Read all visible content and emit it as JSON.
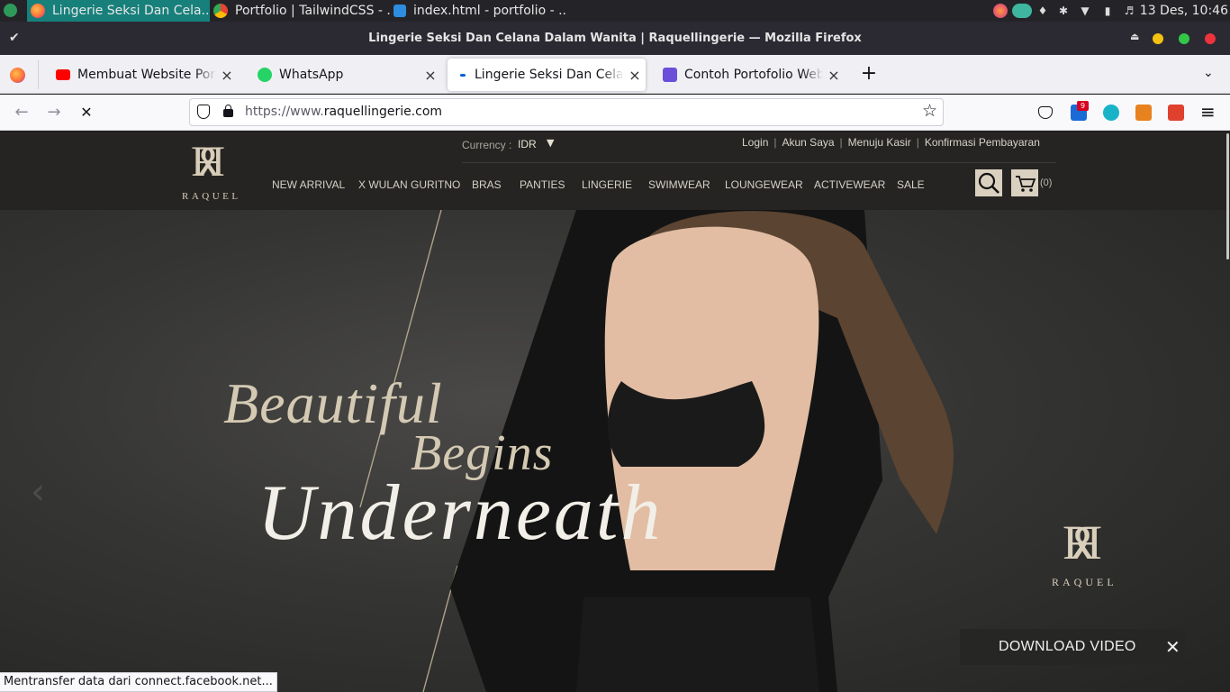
{
  "os_taskbar": {
    "tasks": [
      {
        "label": "Lingerie Seksi Dan Cela..."
      },
      {
        "label": "Portfolio | TailwindCSS - ..."
      },
      {
        "label": "index.html - portfolio - ..."
      }
    ],
    "clock": "13 Des, 10:46"
  },
  "window": {
    "title": "Lingerie Seksi Dan Celana Dalam Wanita | Raquellingerie — Mozilla Firefox"
  },
  "tabs": [
    {
      "label": "Membuat Website Portfolio",
      "close": "×"
    },
    {
      "label": "WhatsApp",
      "close": "×"
    },
    {
      "label": "Lingerie Seksi Dan Celana",
      "close": "×",
      "active": true
    },
    {
      "label": "Contoh Portofolio Web Desain",
      "close": "×"
    }
  ],
  "new_tab": "+",
  "toolbar": {
    "back": "←",
    "forward": "→",
    "stop": "✕",
    "url_scheme": "https://www.",
    "url_host": "raquellingerie.com",
    "bookmark_star": "☆",
    "menu": "≡",
    "badge_count": "9"
  },
  "site": {
    "currency_label": "Currency :",
    "currency_value": "IDR",
    "account_links": [
      "Login",
      "Akun Saya",
      "Menuju Kasir",
      "Konfirmasi Pembayaran"
    ],
    "logo_mark": "R",
    "logo_word": "RAQUEL",
    "nav": [
      "NEW ARRIVAL",
      "X WULAN GURITNO",
      "BRAS",
      "PANTIES",
      "LINGERIE",
      "SWIMWEAR",
      "LOUNGEWEAR",
      "ACTIVEWEAR",
      "SALE"
    ],
    "cart_count": "(0)"
  },
  "hero": {
    "line1": "Beautiful",
    "line2": "Begins",
    "line3": "Underneath",
    "logo_word": "RAQUEL",
    "download_label": "DOWNLOAD VIDEO",
    "download_close": "✕"
  },
  "status_text": "Mentransfer data dari connect.facebook.net..."
}
